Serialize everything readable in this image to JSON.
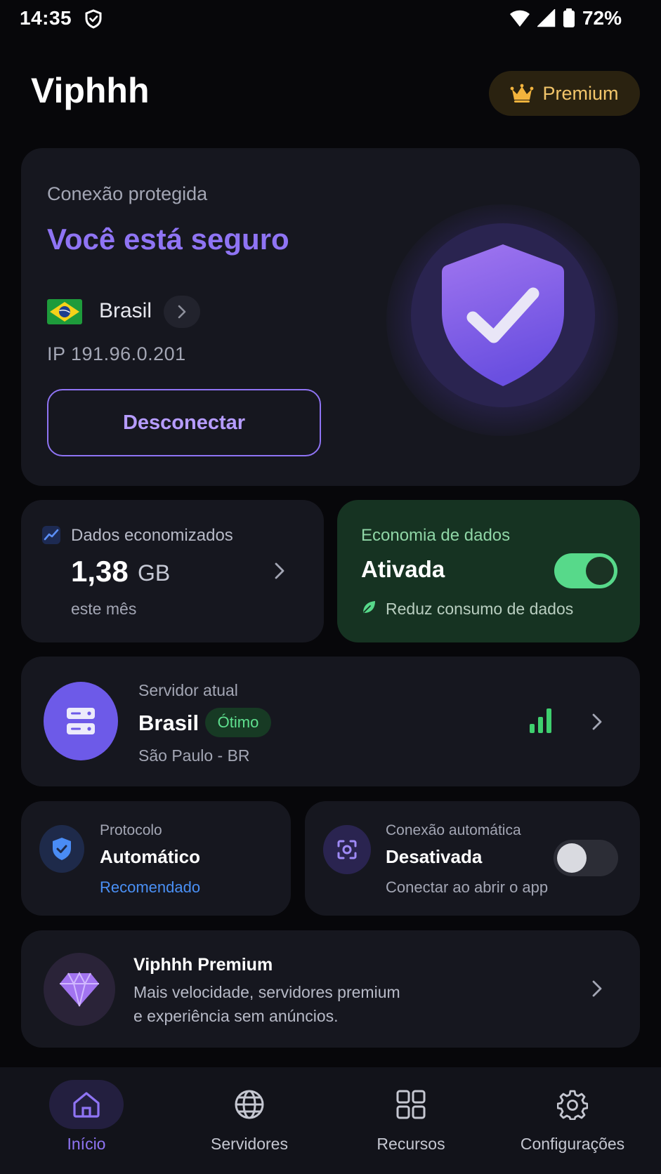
{
  "status_bar": {
    "time": "14:35",
    "battery": "72%",
    "icons": [
      "shield-icon",
      "wifi-icon",
      "signal-icon",
      "battery-icon"
    ]
  },
  "header": {
    "title": "Viphhh",
    "premium_label": "Premium",
    "premium_icon": "crown-icon"
  },
  "connection": {
    "subtitle": "Conexão protegida",
    "title": "Você está seguro",
    "country": "Brasil",
    "ip": "IP 191.96.0.201",
    "disconnect_label": "Desconectar",
    "shield_icon": "shield-check-icon"
  },
  "data_saved": {
    "label": "Dados economizados",
    "value": "1,38",
    "unit": "GB",
    "period": "este mês",
    "icon": "trend-chart-icon"
  },
  "data_saver": {
    "label": "Economia de dados",
    "status": "Ativada",
    "enabled": true,
    "description": "Reduz consumo de dados",
    "icon": "leaf-icon"
  },
  "server": {
    "label": "Servidor atual",
    "name": "Brasil",
    "quality": "Ótimo",
    "city": "São Paulo - BR",
    "icon": "server-icon"
  },
  "protocol": {
    "label": "Protocolo",
    "value": "Automático",
    "hint": "Recomendado",
    "icon": "shield-check-icon"
  },
  "auto_connect": {
    "label": "Conexão automática",
    "value": "Desativada",
    "description": "Conectar ao abrir o app",
    "enabled": false,
    "icon": "focus-icon"
  },
  "promo": {
    "title": "Viphhh Premium",
    "line1": "Mais velocidade, servidores premium",
    "line2": "e experiência sem anúncios.",
    "icon": "diamond-icon"
  },
  "nav": {
    "items": [
      {
        "label": "Início",
        "icon": "home-icon",
        "active": true
      },
      {
        "label": "Servidores",
        "icon": "globe-icon",
        "active": false
      },
      {
        "label": "Recursos",
        "icon": "grid-icon",
        "active": false
      },
      {
        "label": "Configurações",
        "icon": "gear-icon",
        "active": false
      }
    ]
  },
  "colors": {
    "accent": "#8f74f4",
    "success": "#57d98a",
    "premium": "#f2c56a",
    "link": "#4a90f5"
  }
}
